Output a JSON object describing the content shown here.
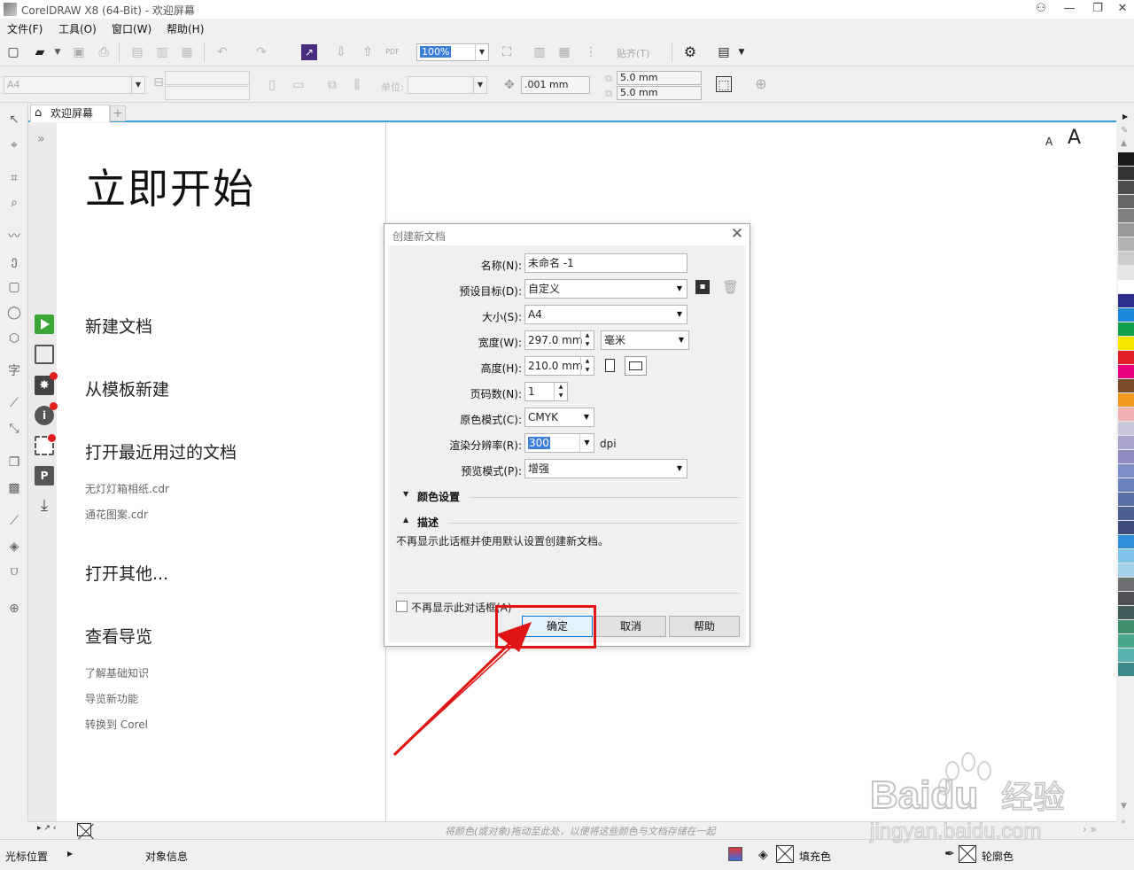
{
  "window": {
    "title": "CorelDRAW X8 (64-Bit) - 欢迎屏幕",
    "min": "—",
    "restore": "❐",
    "close": "✕"
  },
  "menu": [
    "文件(F)",
    "工具(O)",
    "窗口(W)",
    "帮助(H)"
  ],
  "toolbar": {
    "zoom": "100%",
    "snap": "贴齐(T)"
  },
  "propbar": {
    "page_size": "A4",
    "units_label": "单位:",
    "nudge": ".001 mm",
    "dup_x": "5.0 mm",
    "dup_y": "5.0 mm"
  },
  "tab": {
    "label": "欢迎屏幕"
  },
  "welcome": {
    "heading": "立即开始",
    "font_small": "A",
    "font_big": "A",
    "items": {
      "new_doc": "新建文档",
      "from_template": "从模板新建",
      "open_recent": "打开最近用过的文档",
      "recent1": "无灯灯箱相纸.cdr",
      "recent2": "通花图案.cdr",
      "open_other": "打开其他...",
      "tour": "查看导览",
      "learn": "了解基础知识",
      "new_features": "导览新功能",
      "switch": "转换到 Corel"
    }
  },
  "dialog": {
    "title": "创建新文档",
    "name_label": "名称(N):",
    "name_value": "未命名 -1",
    "preset_label": "预设目标(D):",
    "preset_value": "自定义",
    "size_label": "大小(S):",
    "size_value": "A4",
    "width_label": "宽度(W):",
    "width_value": "297.0 mm",
    "unit_value": "毫米",
    "height_label": "高度(H):",
    "height_value": "210.0 mm",
    "pages_label": "页码数(N):",
    "pages_value": "1",
    "color_mode_label": "原色模式(C):",
    "color_mode_value": "CMYK",
    "dpi_label": "渲染分辨率(R):",
    "dpi_value": "300",
    "dpi_unit": "dpi",
    "preview_label": "预览模式(P):",
    "preview_value": "增强",
    "color_settings": "颜色设置",
    "description": "描述",
    "description_text": "不再显示此话框并使用默认设置创建新文档。",
    "dont_show": "不再显示此对话框(A)",
    "ok": "确定",
    "cancel": "取消",
    "help": "帮助"
  },
  "bottom_hint": "将颜色(或对象)拖动至此处，以便将这些颜色与文档存储在一起",
  "status": {
    "cursor_pos": "光标位置",
    "object_info": "对象信息",
    "fill": "填充色",
    "outline": "轮廓色"
  },
  "watermark": {
    "brand": "Baidu",
    "cn": "经验",
    "url": "jingyan.baidu.com"
  },
  "palette": [
    "#1a1a1a",
    "#333333",
    "#4d4d4d",
    "#666666",
    "#808080",
    "#999999",
    "#b3b3b3",
    "#cccccc",
    "#e6e6e6",
    "#ffffff",
    "#2d2d8c",
    "#1e88d8",
    "#11a04a",
    "#f7e600",
    "#e01f26",
    "#e6007e",
    "#7a4a2a",
    "#f39a1e",
    "#f0b2b0",
    "#c9c7dc",
    "#a8a3cf",
    "#8f8bc2",
    "#7d8fc9",
    "#6b83bd",
    "#5a6fa8",
    "#4c5d8f",
    "#3e4c7a",
    "#2f8fd8",
    "#7ec3ea",
    "#a5d1ea",
    "#6e6f72",
    "#4e5054",
    "#3f5c5a",
    "#3e8f6a",
    "#4aa68c",
    "#5ab3b0",
    "#3d8a8a"
  ]
}
